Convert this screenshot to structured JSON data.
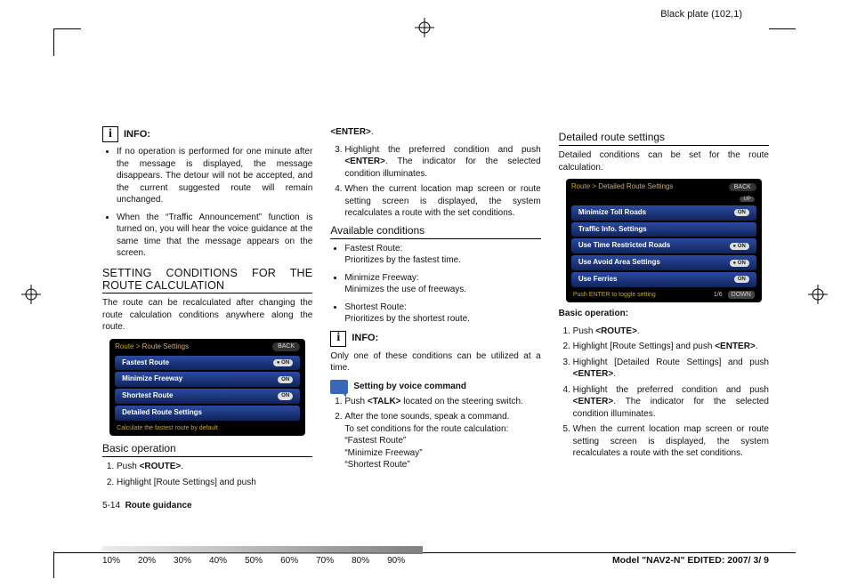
{
  "header": {
    "black_plate": "Black plate (102,1)"
  },
  "col1": {
    "info_label": "INFO:",
    "bullets": [
      "If no operation is performed for one minute after the message is displayed, the message disappears. The detour will not be accepted, and the current suggested route will remain unchanged.",
      "When the “Traffic Announcement” function is turned on, you will hear the voice guidance at the same time that the message appears on the screen."
    ],
    "section_head": "SETTING CONDITIONS FOR THE ROUTE CALCULATION",
    "section_intro": "The route can be recalculated after changing the route calculation conditions anywhere along the route.",
    "screenshot": {
      "title_prefix": "Route >",
      "title": "Route Settings",
      "back": "BACK",
      "rows": [
        {
          "label": "Fastest Route",
          "pill": "● ON"
        },
        {
          "label": "Minimize Freeway",
          "pill": "ON"
        },
        {
          "label": "Shortest Route",
          "pill": "ON"
        },
        {
          "label": "Detailed Route Settings",
          "pill": ""
        }
      ],
      "footer": "Calculate the fastest route by default"
    },
    "basic_op_head": "Basic operation",
    "basic_steps_1": "Push",
    "key_route": "<ROUTE>",
    "basic_step2": "Highlight [Route Settings] and push"
  },
  "col2": {
    "key_enter": "<ENTER>",
    "step3": "Highlight the preferred condition and push",
    "step3_tail": ". The indicator for the selected condition illuminates.",
    "step4": "When the current location map screen or route setting screen is displayed, the system recalculates a route with the set conditions.",
    "avail_head": "Available conditions",
    "avail": [
      {
        "t": "Fastest Route:",
        "d": "Prioritizes by the fastest time."
      },
      {
        "t": "Minimize Freeway:",
        "d": "Minimizes the use of freeways."
      },
      {
        "t": "Shortest Route:",
        "d": "Prioritizes by the shortest route."
      }
    ],
    "info_label": "INFO:",
    "info_text": "Only one of these conditions can be utilized at a time.",
    "voice_label": "Setting by voice command",
    "voice_step1a": "Push",
    "key_talk": "<TALK>",
    "voice_step1b": "located on the steering switch.",
    "voice_step2": "After the tone sounds, speak a command.",
    "voice_prompt": "To set conditions for the route calculation:",
    "voice_opts": [
      "“Fastest Route”",
      "“Minimize Freeway”",
      "“Shortest Route”"
    ]
  },
  "col3": {
    "head": "Detailed route settings",
    "intro": "Detailed conditions can be set for the route calculation.",
    "screenshot": {
      "title_prefix": "Route >",
      "title": "Detailed Route Settings",
      "back": "BACK",
      "up": "UP",
      "rows": [
        {
          "label": "Minimize Toll Roads",
          "pill": "ON"
        },
        {
          "label": "Traffic Info. Settings",
          "pill": ""
        },
        {
          "label": "Use Time Restricted Roads",
          "pill": "● ON"
        },
        {
          "label": "Use Avoid Area Settings",
          "pill": "● ON"
        },
        {
          "label": "Use Ferries",
          "pill": "ON"
        }
      ],
      "footer": "Push ENTER to toggle setting",
      "pager": "1/6",
      "down": "DOWN"
    },
    "basic_head": "Basic operation:",
    "step1a": "Push",
    "key_route": "<ROUTE>",
    "step2": "Highlight [Route Settings] and push",
    "key_enter": "<ENTER>",
    "step3": "Highlight [Detailed Route Settings] and push",
    "step4a": "Highlight the preferred condition and push",
    "step4b": ". The indicator for the selected condition illuminates.",
    "step5": "When the current location map screen or route setting screen is displayed, the system recalculates a route with the set conditions."
  },
  "footer": {
    "pagenum": "5-14",
    "pagesec": "Route guidance",
    "model": "Model \"NAV2-N\" EDITED: 2007/ 3/ 9",
    "pct": [
      "10%",
      "20%",
      "30%",
      "40%",
      "50%",
      "60%",
      "70%",
      "80%",
      "90%"
    ]
  }
}
